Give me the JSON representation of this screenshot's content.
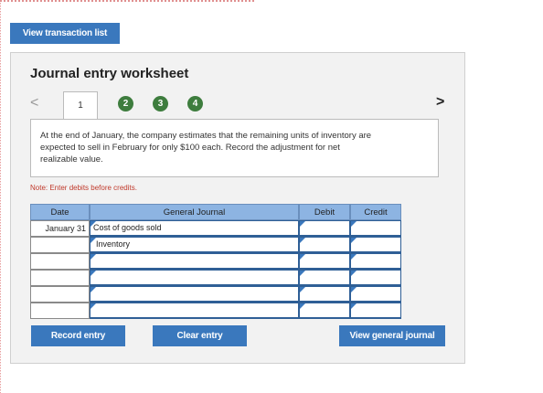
{
  "toolbar": {
    "view_transaction_list": "View transaction list"
  },
  "worksheet": {
    "title": "Journal entry worksheet",
    "nav_prev": "<",
    "nav_next": ">",
    "tabs": [
      {
        "label": "1",
        "active": true
      },
      {
        "label": "2",
        "active": false
      },
      {
        "label": "3",
        "active": false
      },
      {
        "label": "4",
        "active": false
      }
    ],
    "prompt": "At the end of January, the company estimates that the remaining units of inventory are expected to sell in February for only $100 each. Record the adjustment for net realizable value.",
    "note": "Note: Enter debits before credits."
  },
  "journal": {
    "headers": {
      "date": "Date",
      "general_journal": "General Journal",
      "debit": "Debit",
      "credit": "Credit"
    },
    "rows": [
      {
        "date": "January 31",
        "account": "Cost of goods sold",
        "debit": "",
        "credit": ""
      },
      {
        "date": "",
        "account": "Inventory",
        "debit": "",
        "credit": ""
      },
      {
        "date": "",
        "account": "",
        "debit": "",
        "credit": ""
      },
      {
        "date": "",
        "account": "",
        "debit": "",
        "credit": ""
      },
      {
        "date": "",
        "account": "",
        "debit": "",
        "credit": ""
      },
      {
        "date": "",
        "account": "",
        "debit": "",
        "credit": ""
      }
    ]
  },
  "actions": {
    "record_entry": "Record entry",
    "clear_entry": "Clear entry",
    "view_general_journal": "View general journal"
  },
  "colors": {
    "button_blue": "#3a78bd",
    "header_blue": "#8db4e2",
    "tab_green": "#3e7d3e",
    "note_red": "#c0392b"
  }
}
